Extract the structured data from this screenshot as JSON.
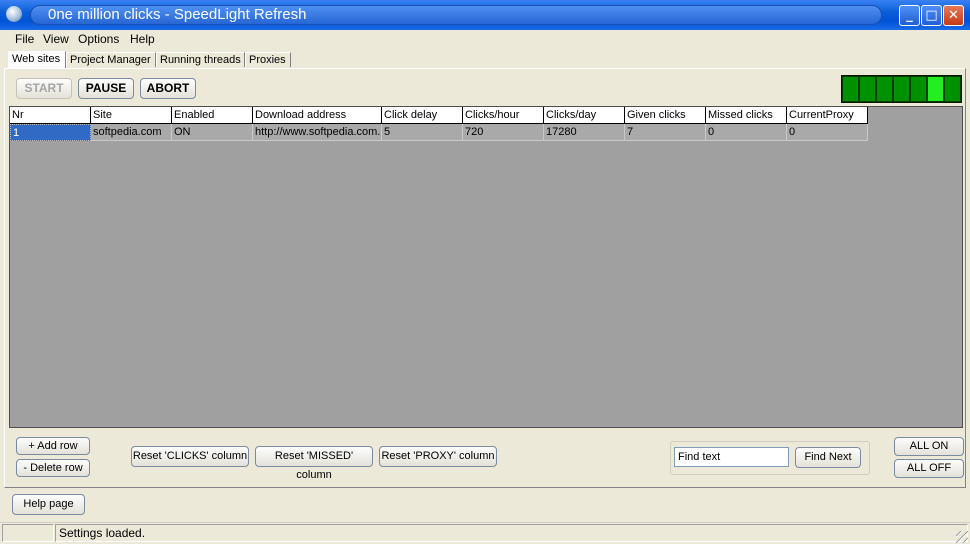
{
  "window": {
    "title": "0ne million clicks - SpeedLight Refresh"
  },
  "menu": [
    {
      "label": "File"
    },
    {
      "label": "View"
    },
    {
      "label": "Options"
    },
    {
      "label": "Help"
    }
  ],
  "tabs": [
    {
      "label": "Web sites"
    },
    {
      "label": "Project Manager"
    },
    {
      "label": "Running threads"
    },
    {
      "label": "Proxies"
    }
  ],
  "toolbar": {
    "start": "START",
    "pause": "PAUSE",
    "abort": "ABORT"
  },
  "leds": {
    "count": 7,
    "active_index": 5,
    "on_color": "#22ee22",
    "off_color": "#009000"
  },
  "grid": {
    "columns": [
      "Nr",
      "Site",
      "Enabled",
      "Download address",
      "Click delay",
      "Clicks/hour",
      "Clicks/day",
      "Given clicks",
      "Missed clicks",
      "CurrentProxy"
    ],
    "rows": [
      [
        "1",
        "softpedia.com",
        "ON",
        "http://www.softpedia.com.",
        "5",
        "720",
        "17280",
        "7",
        "0",
        "0"
      ]
    ]
  },
  "buttons": {
    "add_row": "+ Add row",
    "delete_row": "- Delete row",
    "reset_clicks": "Reset 'CLICKS' column",
    "reset_missed": "Reset 'MISSED' column",
    "reset_proxy": "Reset 'PROXY' column",
    "find_next": "Find Next",
    "all_on": "ALL ON",
    "all_off": "ALL OFF",
    "help_page": "Help page"
  },
  "find": {
    "value": "Find text"
  },
  "status": {
    "message": "Settings loaded."
  }
}
